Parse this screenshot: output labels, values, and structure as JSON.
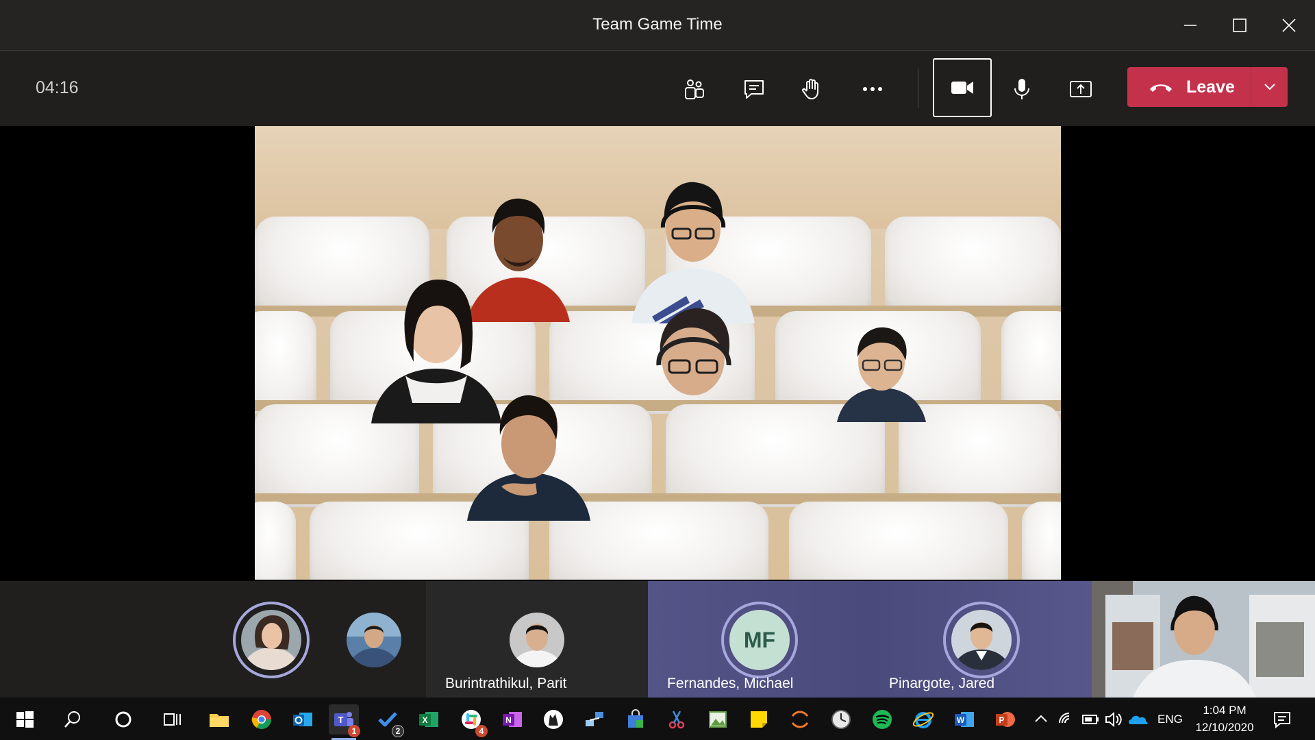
{
  "window": {
    "title": "Team Game Time"
  },
  "controls": {
    "timer": "04:16",
    "leave_label": "Leave"
  },
  "participants": [
    {
      "name": "",
      "avatar": "photo-woman"
    },
    {
      "name": "",
      "avatar": "photo-man-glasses"
    },
    {
      "name": "Burintrathikul, Parit",
      "avatar": "photo-parit"
    },
    {
      "name": "Fernandes, Michael",
      "avatar_initials": "MF"
    },
    {
      "name": "Pinargote, Jared",
      "avatar": "photo-jared"
    }
  ],
  "taskbar": {
    "badges": {
      "teams": "1",
      "todo": "2",
      "slack": "4"
    },
    "language": "ENG",
    "time": "1:04 PM",
    "date": "12/10/2020"
  },
  "colors": {
    "leave": "#c4314b",
    "speaking_ring": "#a6a7dc",
    "titlebar": "#252423",
    "controlbar": "#201f1e",
    "strip_highlight": "#4f4f8a"
  }
}
